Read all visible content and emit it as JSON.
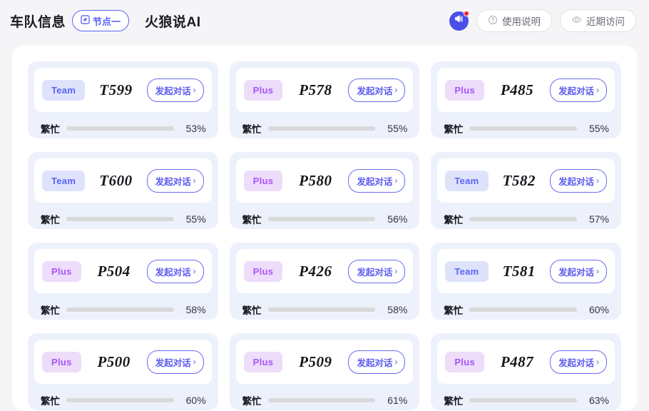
{
  "header": {
    "title": "车队信息",
    "node_pill": {
      "label": "节点一",
      "icon": "node-square-icon"
    },
    "app_name": "火狼说AI",
    "announce": {
      "icon": "megaphone-icon",
      "badge_color": "#f5222d",
      "circle_color": "#4c4ee8"
    },
    "actions": [
      {
        "label": "使用说明",
        "icon": "question-circle-icon"
      },
      {
        "label": "近期访问",
        "icon": "eye-icon"
      }
    ]
  },
  "card_labels": {
    "busy": "繁忙",
    "chat": "发起对话",
    "chevron": "›"
  },
  "colors": {
    "page_bg": "#f5f5f8",
    "panel_bg": "#ffffff",
    "card_bg": "#edf1fb",
    "accent": "#5b63f5",
    "plus_accent": "#a855f7",
    "bar_fill": "#f2706e",
    "bar_track": "#d9d9d9"
  },
  "cards": [
    {
      "tier": "Team",
      "id": "T599",
      "busy_pct": 53,
      "pct_label": "53%"
    },
    {
      "tier": "Plus",
      "id": "P578",
      "busy_pct": 55,
      "pct_label": "55%"
    },
    {
      "tier": "Plus",
      "id": "P485",
      "busy_pct": 55,
      "pct_label": "55%"
    },
    {
      "tier": "Team",
      "id": "T600",
      "busy_pct": 55,
      "pct_label": "55%"
    },
    {
      "tier": "Plus",
      "id": "P580",
      "busy_pct": 56,
      "pct_label": "56%"
    },
    {
      "tier": "Team",
      "id": "T582",
      "busy_pct": 57,
      "pct_label": "57%"
    },
    {
      "tier": "Plus",
      "id": "P504",
      "busy_pct": 58,
      "pct_label": "58%"
    },
    {
      "tier": "Plus",
      "id": "P426",
      "busy_pct": 58,
      "pct_label": "58%"
    },
    {
      "tier": "Team",
      "id": "T581",
      "busy_pct": 60,
      "pct_label": "60%"
    },
    {
      "tier": "Plus",
      "id": "P500",
      "busy_pct": 60,
      "pct_label": "60%"
    },
    {
      "tier": "Plus",
      "id": "P509",
      "busy_pct": 61,
      "pct_label": "61%"
    },
    {
      "tier": "Plus",
      "id": "P487",
      "busy_pct": 63,
      "pct_label": "63%"
    }
  ]
}
